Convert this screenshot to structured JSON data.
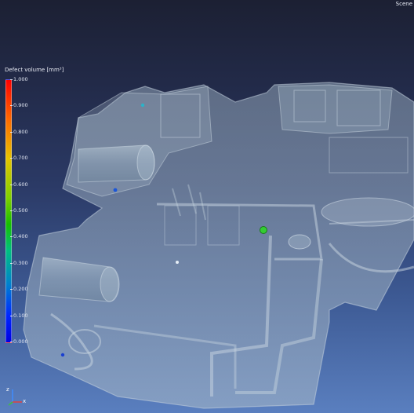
{
  "scene": {
    "label": "Scene"
  },
  "legend": {
    "title": "Defect volume [mm³]",
    "ticks": [
      "1.000",
      "0.900",
      "0.800",
      "0.700",
      "0.600",
      "0.500",
      "0.400",
      "0.300",
      "0.200",
      "0.100",
      "0.000"
    ]
  },
  "gizmo": {
    "x_label": "x",
    "z_label": "z"
  },
  "colors": {
    "background_top": "#1c2033",
    "background_bottom": "#5a7fbf",
    "part": "#9ab0c4",
    "defect_green": "#33cc33"
  }
}
